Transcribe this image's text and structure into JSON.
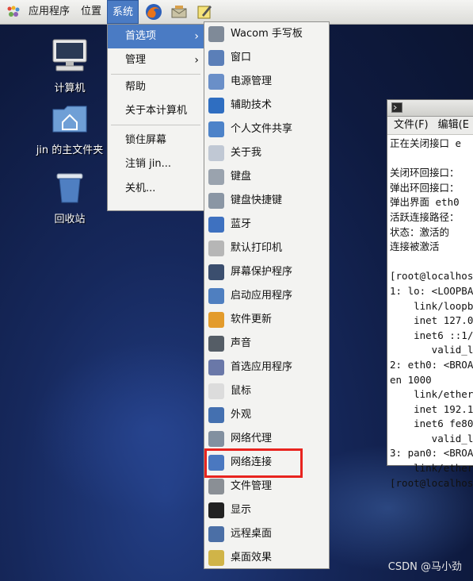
{
  "panel": {
    "applications": "应用程序",
    "places": "位置",
    "system": "系统"
  },
  "desktop": {
    "computer": "计算机",
    "home": "jin 的主文件夹",
    "trash": "回收站"
  },
  "system_menu": [
    {
      "label": "首选项",
      "submenu": true
    },
    {
      "label": "管理",
      "submenu": true
    },
    {
      "label": "帮助",
      "submenu": false
    },
    {
      "label": "关于本计算机",
      "submenu": false
    },
    {
      "label": "锁住屏幕",
      "submenu": false
    },
    {
      "label": "注销 jin...",
      "submenu": false
    },
    {
      "label": "关机...",
      "submenu": false
    }
  ],
  "preferences_menu": [
    {
      "label": "Wacom 手写板",
      "icon": "tablet-icon"
    },
    {
      "label": "窗口",
      "icon": "window-icon"
    },
    {
      "label": "电源管理",
      "icon": "power-icon"
    },
    {
      "label": "辅助技术",
      "icon": "accessibility-icon"
    },
    {
      "label": "个人文件共享",
      "icon": "folder-share-icon"
    },
    {
      "label": "关于我",
      "icon": "about-me-icon"
    },
    {
      "label": "键盘",
      "icon": "keyboard-icon"
    },
    {
      "label": "键盘快捷键",
      "icon": "keyboard-shortcuts-icon"
    },
    {
      "label": "蓝牙",
      "icon": "bluetooth-icon"
    },
    {
      "label": "默认打印机",
      "icon": "printer-icon"
    },
    {
      "label": "屏幕保护程序",
      "icon": "screensaver-icon"
    },
    {
      "label": "启动应用程序",
      "icon": "startup-apps-icon"
    },
    {
      "label": "软件更新",
      "icon": "software-update-icon"
    },
    {
      "label": "声音",
      "icon": "sound-icon"
    },
    {
      "label": "首选应用程序",
      "icon": "preferred-apps-icon"
    },
    {
      "label": "鼠标",
      "icon": "mouse-icon"
    },
    {
      "label": "外观",
      "icon": "appearance-icon"
    },
    {
      "label": "网络代理",
      "icon": "network-proxy-icon"
    },
    {
      "label": "网络连接",
      "icon": "network-connections-icon"
    },
    {
      "label": "文件管理",
      "icon": "file-management-icon"
    },
    {
      "label": "显示",
      "icon": "display-icon"
    },
    {
      "label": "远程桌面",
      "icon": "remote-desktop-icon"
    },
    {
      "label": "桌面效果",
      "icon": "desktop-effects-icon"
    }
  ],
  "terminal": {
    "menu_file": "文件(F)",
    "menu_edit": "编辑(E",
    "lines": [
      "正在关闭接口 e",
      "",
      "关闭环回接口：",
      "弹出环回接口：",
      "弹出界面 eth0",
      "活跃连接路径：",
      "状态：激活的",
      "连接被激活",
      "",
      "[root@localhos",
      "1: lo: <LOOPBA",
      "    link/loopb",
      "    inet 127.0",
      "    inet6 ::1/",
      "       valid_l",
      "2: eth0: <BROA",
      "en 1000",
      "    link/ether",
      "    inet 192.1",
      "    inet6 fe80",
      "       valid_l",
      "3: pan0: <BROA",
      "    link/ether",
      "[root@localhos"
    ]
  },
  "watermark": "CSDN @马小劲",
  "colors": {
    "highlight": "#4a7bc4",
    "annotation_box": "#e8241f"
  }
}
